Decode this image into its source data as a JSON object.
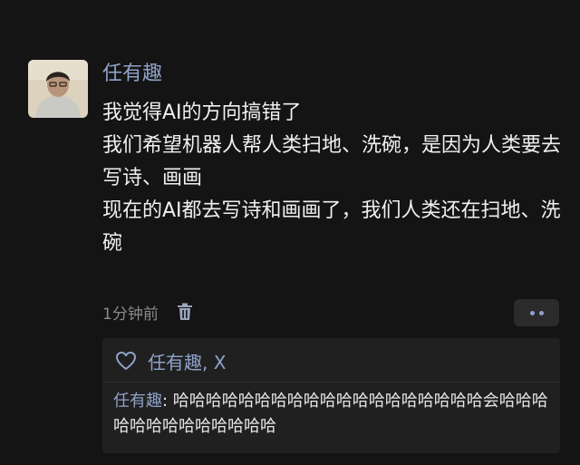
{
  "post": {
    "author": "任有趣",
    "lines": [
      "我觉得AI的方向搞错了",
      "我们希望机器人帮人类扫地、洗碗，是因为人类要去写诗、画画",
      "现在的AI都去写诗和画画了，我们人类还在扫地、洗碗"
    ],
    "time": "1分钟前"
  },
  "likes": {
    "names": "任有趣, X"
  },
  "comment": {
    "author": "任有趣",
    "separator": ": ",
    "text": "哈哈哈哈哈哈哈哈哈哈哈哈哈哈哈哈哈哈哈会哈哈哈哈哈哈哈哈哈哈哈哈哈"
  },
  "colors": {
    "background": "#141414",
    "name_link": "#8fa2c8",
    "body_text": "#f0f0f0",
    "muted": "#8a8a8a",
    "panel": "#202020"
  },
  "icons": {
    "delete": "trash-icon",
    "more": "more-icon",
    "like": "heart-icon"
  }
}
